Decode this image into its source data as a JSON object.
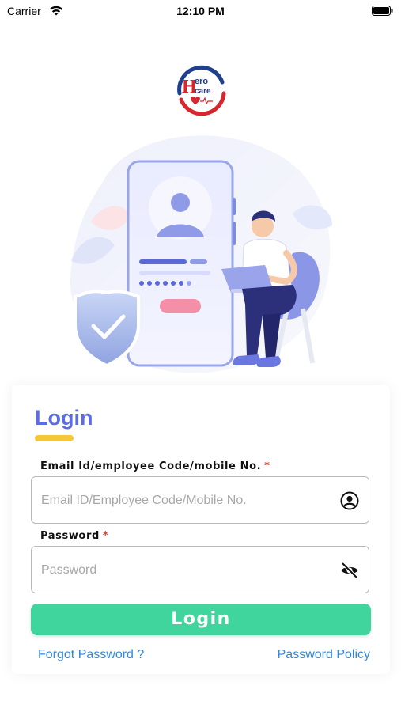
{
  "status_bar": {
    "carrier": "Carrier",
    "time": "12:10 PM"
  },
  "logo": {
    "line1": "ero",
    "line2": "care",
    "letter": "H"
  },
  "login": {
    "title": "Login",
    "email_label": "Email Id/employee Code/mobile No.",
    "email_placeholder": "Email ID/Employee Code/Mobile No.",
    "email_value": "",
    "password_label": "Password",
    "password_placeholder": "Password",
    "password_value": "",
    "required_mark": "*",
    "button_label": "Login",
    "forgot_password": "Forgot Password ?",
    "password_policy": "Password Policy"
  },
  "icons": {
    "email_field_icon": "account-circle-icon",
    "password_field_icon": "eye-off-icon",
    "wifi": "wifi-icon",
    "battery": "battery-icon"
  },
  "colors": {
    "title": "#5b6de0",
    "underline": "#f5c83a",
    "button": "#3fd59c",
    "link": "#2c88e0",
    "required": "#e53935"
  }
}
